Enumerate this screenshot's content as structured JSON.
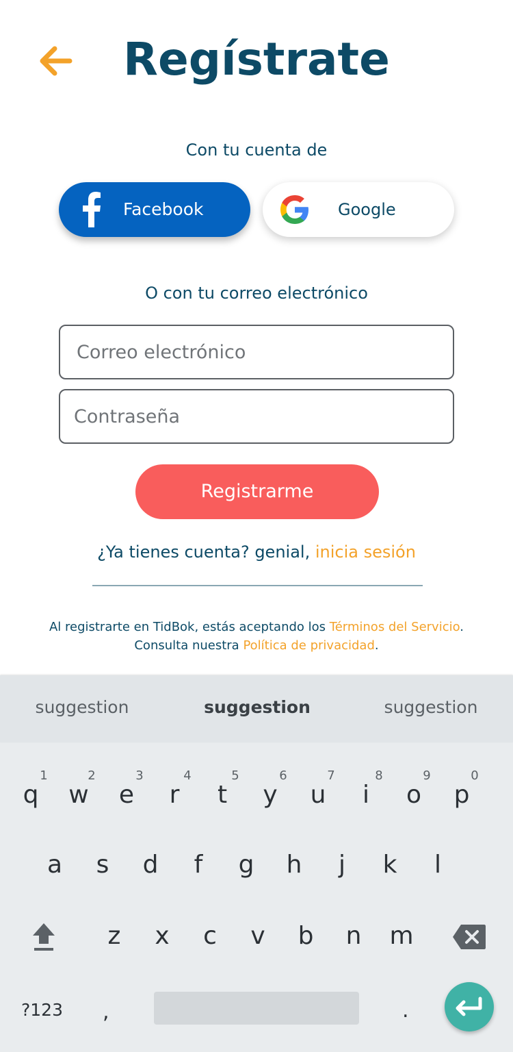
{
  "header": {
    "title": "Regístrate",
    "back_icon": "arrow-left-icon",
    "back_color": "#f3a22a"
  },
  "social": {
    "prompt": "Con tu cuenta de",
    "facebook_label": "Facebook",
    "google_label": "Google"
  },
  "email_section": {
    "prompt": "O con tu correo electrónico",
    "email_placeholder": "Correo electrónico",
    "password_placeholder": "Contraseña",
    "register_label": "Registrarme"
  },
  "login": {
    "text": "¿Ya tienes cuenta? genial, ",
    "link": "inicia sesión"
  },
  "terms": {
    "line1_text": "Al registrarte en TidBok, estás aceptando los ",
    "line1_link": "Términos del Servicio",
    "line1_end": ".",
    "line2_text": "Consulta nuestra ",
    "line2_link": "Política de privacidad",
    "line2_end": "."
  },
  "colors": {
    "primary_dark": "#0d4a66",
    "accent_orange": "#f3a22a",
    "facebook_blue": "#0563c0",
    "register_red": "#f95d5c",
    "keyboard_enter": "#40b2a6"
  },
  "keyboard": {
    "suggestions": [
      "suggestion",
      "suggestion",
      "suggestion"
    ],
    "row1": [
      {
        "key": "q",
        "hint": "1"
      },
      {
        "key": "w",
        "hint": "2"
      },
      {
        "key": "e",
        "hint": "3"
      },
      {
        "key": "r",
        "hint": "4"
      },
      {
        "key": "t",
        "hint": "5"
      },
      {
        "key": "y",
        "hint": "6"
      },
      {
        "key": "u",
        "hint": "7"
      },
      {
        "key": "i",
        "hint": "8"
      },
      {
        "key": "o",
        "hint": "9"
      },
      {
        "key": "p",
        "hint": "0"
      }
    ],
    "row2": [
      "a",
      "s",
      "d",
      "f",
      "g",
      "h",
      "j",
      "k",
      "l"
    ],
    "row3": [
      "z",
      "x",
      "c",
      "v",
      "b",
      "n",
      "m"
    ],
    "symbols_label": "?123",
    "comma": ",",
    "period": "."
  }
}
